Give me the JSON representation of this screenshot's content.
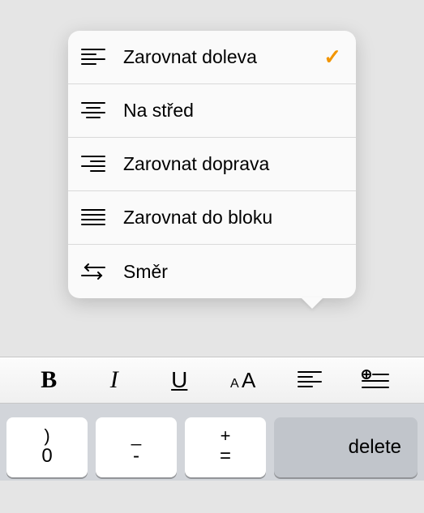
{
  "menu": {
    "items": [
      {
        "label": "Zarovnat doleva",
        "icon": "align-left-icon",
        "selected": true
      },
      {
        "label": "Na střed",
        "icon": "align-center-icon",
        "selected": false
      },
      {
        "label": "Zarovnat doprava",
        "icon": "align-right-icon",
        "selected": false
      },
      {
        "label": "Zarovnat do bloku",
        "icon": "align-justify-icon",
        "selected": false
      },
      {
        "label": "Směr",
        "icon": "direction-icon",
        "selected": false
      }
    ]
  },
  "toolbar": {
    "bold": "B",
    "italic": "I",
    "underline": "U"
  },
  "keyboard": {
    "k0_top": ")",
    "k0_bot": "0",
    "km_top": "_",
    "km_bot": "-",
    "kp_top": "+",
    "kp_bot": "=",
    "delete": "delete"
  }
}
